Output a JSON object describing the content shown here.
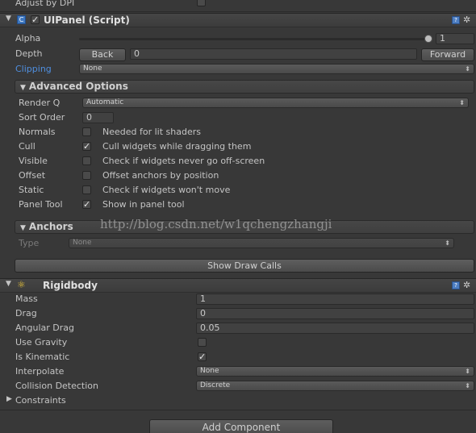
{
  "top_row": {
    "label": "Adjust by DPI"
  },
  "uipanel": {
    "title": "UIPanel (Script)",
    "alpha_label": "Alpha",
    "alpha_value": "1",
    "depth_label": "Depth",
    "back_label": "Back",
    "depth_value": "0",
    "forward_label": "Forward",
    "clipping_label": "Clipping",
    "clipping_value": "None",
    "advanced_title": "Advanced Options",
    "render_q_label": "Render Q",
    "render_q_value": "Automatic",
    "sort_order_label": "Sort Order",
    "sort_order_value": "0",
    "options": [
      {
        "label": "Normals",
        "checked": false,
        "desc": "Needed for lit shaders"
      },
      {
        "label": "Cull",
        "checked": true,
        "desc": "Cull widgets while dragging them"
      },
      {
        "label": "Visible",
        "checked": false,
        "desc": "Check if widgets never go off-screen"
      },
      {
        "label": "Offset",
        "checked": false,
        "desc": "Offset anchors by position"
      },
      {
        "label": "Static",
        "checked": false,
        "desc": "Check if widgets won't move"
      },
      {
        "label": "Panel Tool",
        "checked": true,
        "desc": "Show in panel tool"
      }
    ],
    "anchors_title": "Anchors",
    "type_label": "Type",
    "type_value": "None",
    "show_draw_calls": "Show Draw Calls"
  },
  "watermark": "http://blog.csdn.net/w1qchengzhangji",
  "rigidbody": {
    "title": "Rigidbody",
    "mass_label": "Mass",
    "mass_value": "1",
    "drag_label": "Drag",
    "drag_value": "0",
    "angular_drag_label": "Angular Drag",
    "angular_drag_value": "0.05",
    "use_gravity_label": "Use Gravity",
    "use_gravity_checked": false,
    "is_kinematic_label": "Is Kinematic",
    "is_kinematic_checked": true,
    "interpolate_label": "Interpolate",
    "interpolate_value": "None",
    "collision_label": "Collision Detection",
    "collision_value": "Discrete",
    "constraints_label": "Constraints"
  },
  "add_component": "Add Component",
  "colors": {
    "background": "#383838",
    "clipping_label": "#4f8fe0",
    "help_icon": "#4d7ec2"
  },
  "icons": {
    "help": "help-book-icon",
    "gear": "gear-icon",
    "script": "script-icon",
    "rigidbody": "rigidbody-icon",
    "check": "check-icon"
  }
}
